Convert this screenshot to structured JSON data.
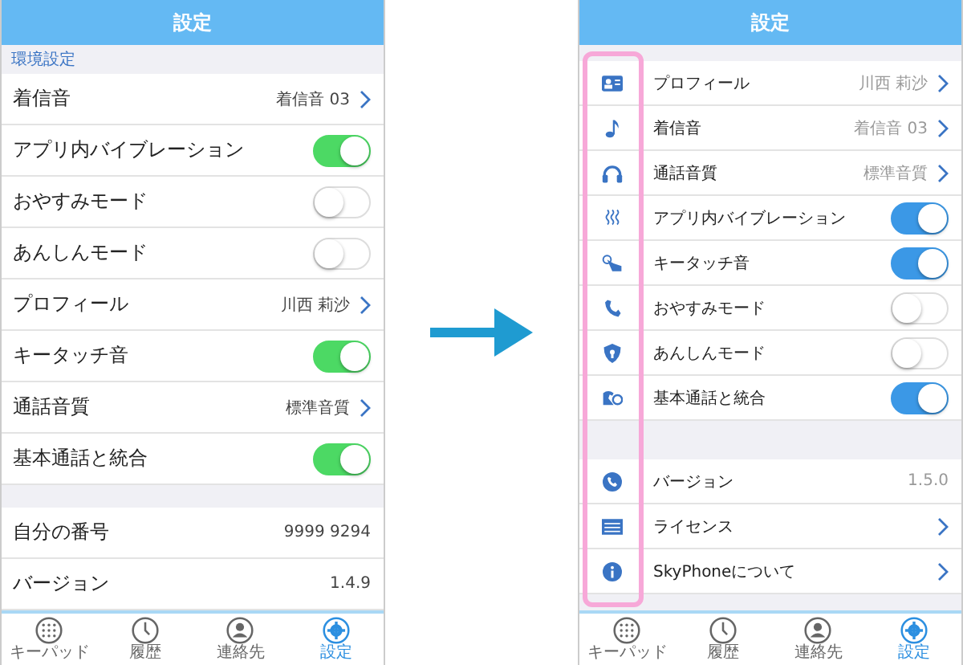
{
  "screens": [
    {
      "kind": "classic",
      "title": "設定",
      "section": "環境設定",
      "groups": [
        [
          {
            "kind": "link",
            "label": "着信音",
            "value": "着信音 03"
          },
          {
            "kind": "toggle",
            "label": "アプリ内バイブレーション",
            "on": true
          },
          {
            "kind": "toggle",
            "label": "おやすみモード",
            "on": false
          },
          {
            "kind": "toggle",
            "label": "あんしんモード",
            "on": false
          },
          {
            "kind": "link",
            "label": "プロフィール",
            "value": "川西 莉沙"
          },
          {
            "kind": "toggle",
            "label": "キータッチ音",
            "on": true
          },
          {
            "kind": "link",
            "label": "通話音質",
            "value": "標準音質"
          },
          {
            "kind": "toggle",
            "label": "基本通話と統合",
            "on": true
          }
        ],
        [
          {
            "kind": "info",
            "label": "自分の番号",
            "value": "9999 9294"
          },
          {
            "kind": "info",
            "label": "バージョン",
            "value": "1.4.9"
          }
        ]
      ],
      "tabs": [
        {
          "label": "キーパッド",
          "selected": false
        },
        {
          "label": "履歴",
          "selected": false
        },
        {
          "label": "連絡先",
          "selected": false
        },
        {
          "label": "設定",
          "selected": true
        }
      ]
    },
    {
      "kind": "modern",
      "title": "設定",
      "highlight": true,
      "groups": [
        [
          {
            "kind": "link",
            "label": "プロフィール",
            "value": "川西 莉沙"
          },
          {
            "kind": "link",
            "label": "着信音",
            "value": "着信音 03"
          },
          {
            "kind": "link",
            "label": "通話音質",
            "value": "標準音質"
          },
          {
            "kind": "toggle",
            "label": "アプリ内バイブレーション",
            "on": true
          },
          {
            "kind": "toggle",
            "label": "キータッチ音",
            "on": true
          },
          {
            "kind": "toggle",
            "label": "おやすみモード",
            "on": false
          },
          {
            "kind": "toggle",
            "label": "あんしんモード",
            "on": false
          },
          {
            "kind": "toggle",
            "label": "基本通話と統合",
            "on": true
          }
        ],
        [
          {
            "kind": "info",
            "label": "バージョン",
            "value": "1.5.0"
          },
          {
            "kind": "link",
            "label": "ライセンス"
          },
          {
            "kind": "link",
            "label": "SkyPhoneについて"
          }
        ]
      ],
      "tabs": [
        {
          "label": "キーパッド",
          "selected": false
        },
        {
          "label": "履歴",
          "selected": false
        },
        {
          "label": "連絡先",
          "selected": false
        },
        {
          "label": "設定",
          "selected": true
        }
      ]
    }
  ]
}
